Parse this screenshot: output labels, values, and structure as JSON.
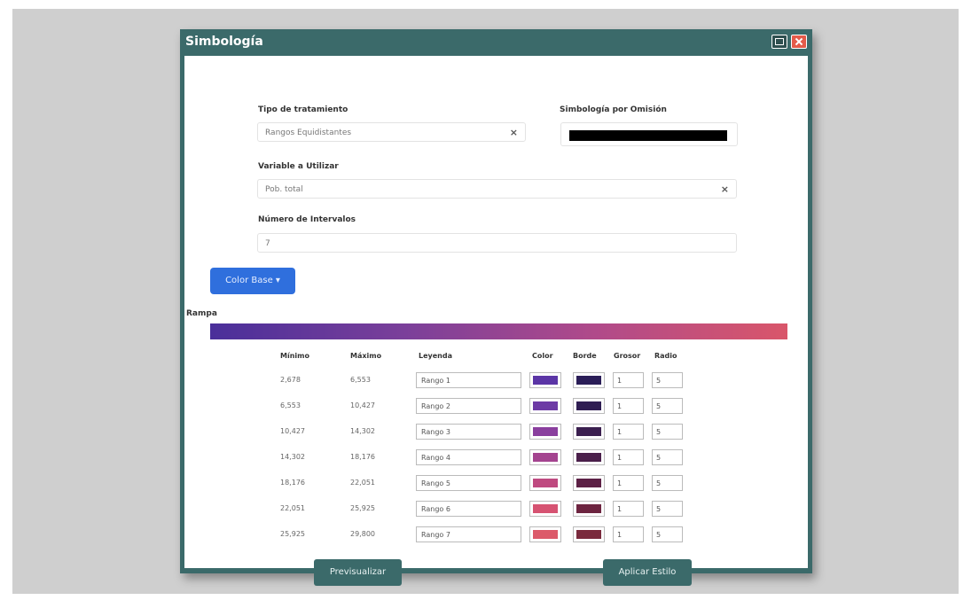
{
  "window": {
    "title": "Simbología"
  },
  "form": {
    "tipo_label": "Tipo de tratamiento",
    "tipo_value": "Rangos Equidistantes",
    "tipo_clear": "×",
    "omision_label": "Simbología por Omisión",
    "variable_label": "Variable a Utilizar",
    "variable_value": "Pob. total",
    "variable_clear": "×",
    "intervalos_label": "Número de Intervalos",
    "intervalos_value": "7"
  },
  "color_base_button": "Color Base ▾",
  "rampa_label": "Rampa",
  "colors": {
    "titlebar": "#3b6a6a",
    "primary_button": "#2f6fdd",
    "ramp_start": "#4a2f9a",
    "ramp_end": "#d9566a"
  },
  "table": {
    "headers": [
      "Mínimo",
      "Máximo",
      "Leyenda",
      "Color",
      "Borde",
      "Grosor",
      "Radio"
    ],
    "rows": [
      {
        "min": "2,678",
        "max": "6,553",
        "legend": "Rango 1",
        "color": "#5b35a6",
        "border": "#2a1d57",
        "grosor": "1",
        "radio": "5"
      },
      {
        "min": "6,553",
        "max": "10,427",
        "legend": "Rango 2",
        "color": "#6d3aa5",
        "border": "#2f1d52",
        "grosor": "1",
        "radio": "5"
      },
      {
        "min": "10,427",
        "max": "14,302",
        "legend": "Rango 3",
        "color": "#8a3f9e",
        "border": "#3b1f4f",
        "grosor": "1",
        "radio": "5"
      },
      {
        "min": "14,302",
        "max": "18,176",
        "legend": "Rango 4",
        "color": "#a4448f",
        "border": "#4a1f4a",
        "grosor": "1",
        "radio": "5"
      },
      {
        "min": "18,176",
        "max": "22,051",
        "legend": "Rango 5",
        "color": "#bf4a80",
        "border": "#5c2045",
        "grosor": "1",
        "radio": "5"
      },
      {
        "min": "22,051",
        "max": "25,925",
        "legend": "Rango 6",
        "color": "#d65372",
        "border": "#6d2440",
        "grosor": "1",
        "radio": "5"
      },
      {
        "min": "25,925",
        "max": "29,800",
        "legend": "Rango 7",
        "color": "#dc5a6a",
        "border": "#7a2a3d",
        "grosor": "1",
        "radio": "5"
      }
    ]
  },
  "buttons": {
    "preview": "Previsualizar",
    "apply": "Aplicar Estilo"
  }
}
